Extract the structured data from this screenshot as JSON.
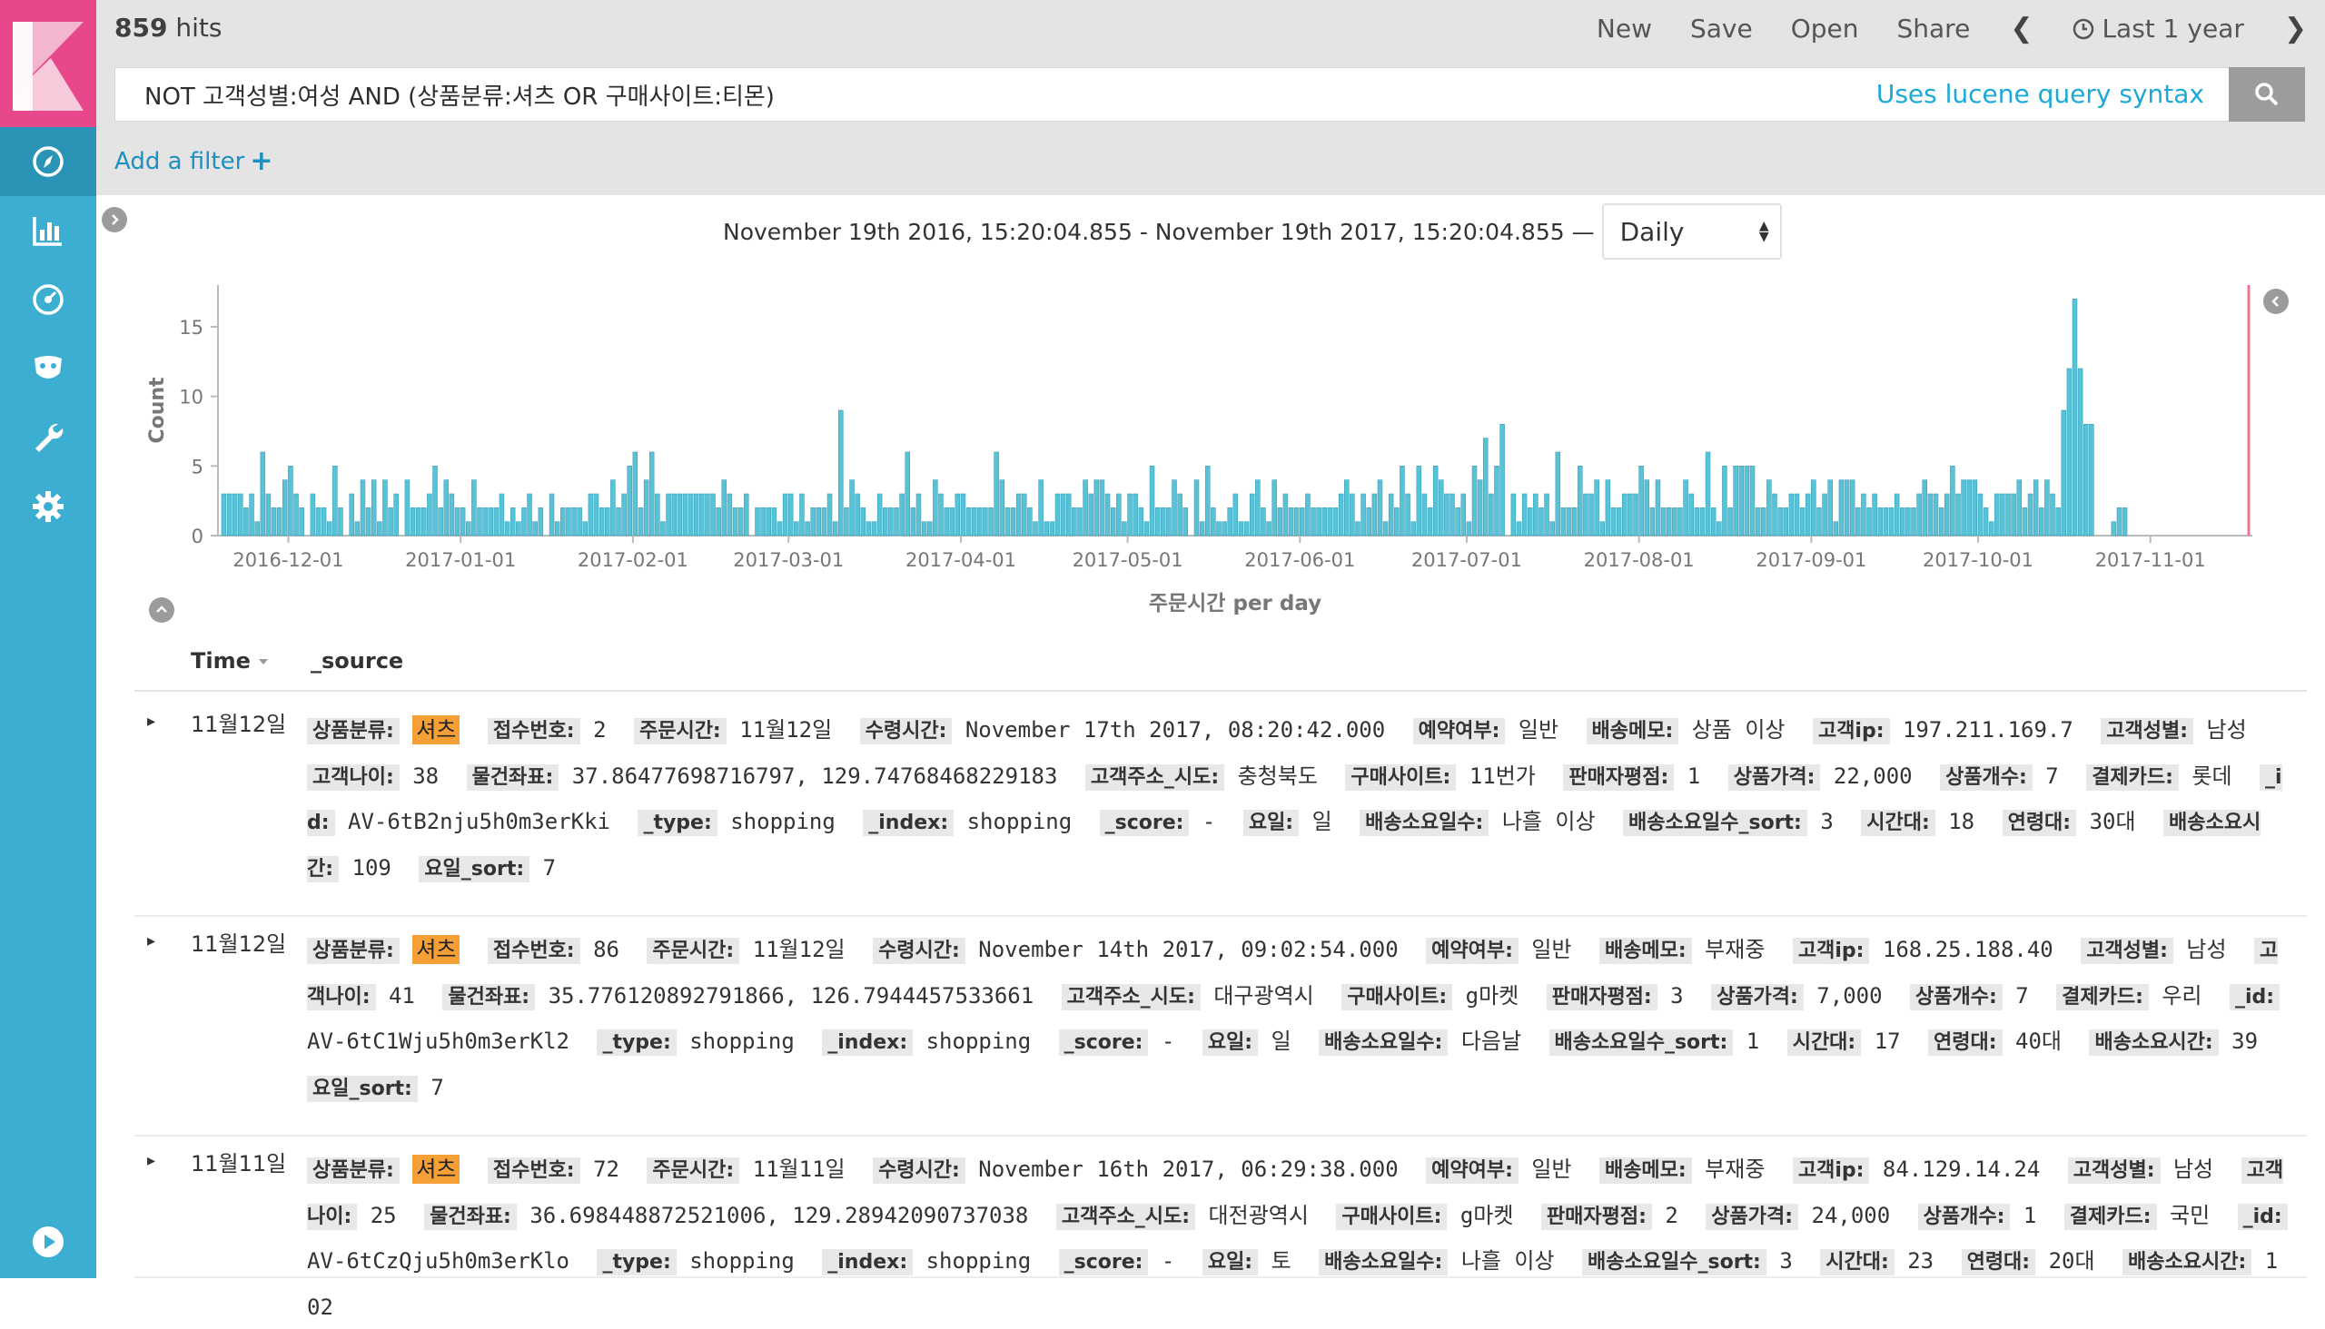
{
  "app": {
    "accent": "#3caed2",
    "logo_color": "#e8488b"
  },
  "sidebar": {
    "items": [
      {
        "name": "discover",
        "icon": "compass-icon",
        "active": true
      },
      {
        "name": "visualize",
        "icon": "bar-chart-icon"
      },
      {
        "name": "dashboard",
        "icon": "dashboard-gauge-icon"
      },
      {
        "name": "timelion",
        "icon": "timelion-mask-icon"
      },
      {
        "name": "dev-tools",
        "icon": "wrench-icon"
      },
      {
        "name": "management",
        "icon": "gear-icon"
      }
    ],
    "bottom_icon": "play-circle-icon"
  },
  "header": {
    "hits_count": "859",
    "hits_label": "hits",
    "menu": {
      "new": "New",
      "save": "Save",
      "open": "Open",
      "share": "Share"
    },
    "time_range_label": "Last 1 year"
  },
  "query": {
    "value": "NOT 고객성별:여성 AND (상품분류:셔츠 OR 구매사이트:티몬)",
    "syntax_link": "Uses lucene query syntax"
  },
  "filter": {
    "add_label": "Add a filter"
  },
  "chart_meta": {
    "range_text": "November 19th 2016, 15:20:04.855 - November 19th 2017, 15:20:04.855 —",
    "interval": "Daily"
  },
  "chart_data": {
    "type": "bar",
    "ylabel": "Count",
    "xlabel": "주문시간 per day",
    "ylim": [
      0,
      18
    ],
    "yticks": [
      0,
      5,
      10,
      15
    ],
    "xticks": [
      "2016-12-01",
      "2017-01-01",
      "2017-02-01",
      "2017-03-01",
      "2017-04-01",
      "2017-05-01",
      "2017-06-01",
      "2017-07-01",
      "2017-08-01",
      "2017-09-01",
      "2017-10-01",
      "2017-11-01"
    ],
    "start_date": "2016-11-19",
    "values": [
      3,
      3,
      3,
      3,
      2,
      3,
      1,
      6,
      3,
      2,
      2,
      4,
      5,
      3,
      2,
      0,
      3,
      2,
      2,
      1,
      5,
      2,
      0,
      3,
      1,
      4,
      2,
      4,
      1,
      4,
      2,
      3,
      0,
      4,
      2,
      2,
      2,
      3,
      5,
      2,
      4,
      3,
      2,
      2,
      1,
      4,
      2,
      2,
      2,
      2,
      3,
      1,
      2,
      1,
      2,
      3,
      1,
      2,
      0,
      3,
      1,
      2,
      2,
      2,
      2,
      1,
      3,
      3,
      2,
      2,
      4,
      2,
      3,
      5,
      6,
      2,
      4,
      6,
      3,
      1,
      3,
      3,
      3,
      3,
      3,
      3,
      3,
      3,
      3,
      2,
      4,
      3,
      2,
      2,
      3,
      0,
      2,
      2,
      2,
      2,
      1,
      3,
      3,
      1,
      3,
      1,
      2,
      2,
      2,
      3,
      1,
      9,
      2,
      4,
      3,
      2,
      1,
      1,
      3,
      2,
      2,
      2,
      3,
      6,
      2,
      3,
      1,
      1,
      4,
      3,
      2,
      2,
      3,
      3,
      2,
      2,
      2,
      2,
      2,
      6,
      4,
      2,
      2,
      3,
      3,
      2,
      1,
      4,
      1,
      1,
      3,
      3,
      3,
      2,
      2,
      4,
      3,
      4,
      4,
      3,
      2,
      3,
      1,
      3,
      3,
      2,
      1,
      5,
      2,
      2,
      2,
      4,
      3,
      2,
      0,
      4,
      1,
      5,
      2,
      1,
      1,
      2,
      3,
      1,
      1,
      3,
      4,
      2,
      1,
      4,
      2,
      3,
      2,
      2,
      2,
      3,
      2,
      2,
      2,
      2,
      2,
      3,
      4,
      3,
      1,
      3,
      2,
      3,
      4,
      1,
      3,
      2,
      5,
      3,
      1,
      5,
      3,
      2,
      5,
      4,
      3,
      3,
      2,
      3,
      1,
      5,
      4,
      7,
      3,
      5,
      8,
      0,
      3,
      1,
      3,
      2,
      3,
      2,
      3,
      1,
      6,
      2,
      2,
      2,
      5,
      3,
      3,
      4,
      1,
      4,
      2,
      2,
      3,
      3,
      3,
      5,
      4,
      2,
      4,
      2,
      2,
      2,
      2,
      4,
      3,
      2,
      2,
      6,
      2,
      1,
      5,
      2,
      5,
      5,
      5,
      5,
      2,
      2,
      4,
      3,
      2,
      2,
      3,
      3,
      2,
      3,
      4,
      2,
      3,
      4,
      1,
      4,
      4,
      4,
      2,
      3,
      2,
      3,
      2,
      2,
      2,
      3,
      2,
      2,
      2,
      3,
      4,
      3,
      3,
      2,
      3,
      5,
      3,
      4,
      4,
      4,
      3,
      2,
      1,
      3,
      3,
      3,
      3,
      4,
      2,
      3,
      4,
      2,
      4,
      3,
      2,
      9,
      12,
      17,
      12,
      8,
      8,
      0,
      0,
      0,
      1,
      2,
      2
    ],
    "highlight_color": "#57c3d8"
  },
  "table": {
    "col_time": "Time",
    "col_source": "_source",
    "rows": [
      {
        "time": "11월12일",
        "fields": [
          {
            "k": "상품분류:",
            "v": "셔츠",
            "hl": true
          },
          {
            "k": "접수번호:",
            "v": "2"
          },
          {
            "k": "주문시간:",
            "v": "11월12일"
          },
          {
            "k": "수령시간:",
            "v": "November 17th 2017, 08:20:42.000"
          },
          {
            "k": "예약여부:",
            "v": "일반"
          },
          {
            "k": "배송메모:",
            "v": "상품 이상"
          },
          {
            "k": "고객ip:",
            "v": "197.211.169.7"
          },
          {
            "k": "고객성별:",
            "v": "남성"
          },
          {
            "k": "고객나이:",
            "v": "38"
          },
          {
            "k": "물건좌표:",
            "v": "37.86477698716797, 129.74768468229183"
          },
          {
            "k": "고객주소_시도:",
            "v": "충청북도"
          },
          {
            "k": "구매사이트:",
            "v": "11번가"
          },
          {
            "k": "판매자평점:",
            "v": "1"
          },
          {
            "k": "상품가격:",
            "v": "22,000"
          },
          {
            "k": "상품개수:",
            "v": "7"
          },
          {
            "k": "결제카드:",
            "v": "롯데"
          },
          {
            "k": "_id:",
            "v": "AV-6tB2nju5h0m3erKki"
          },
          {
            "k": "_type:",
            "v": "shopping"
          },
          {
            "k": "_index:",
            "v": "shopping"
          },
          {
            "k": "_score:",
            "v": "-"
          },
          {
            "k": "요일:",
            "v": "일"
          },
          {
            "k": "배송소요일수:",
            "v": "나흘 이상"
          },
          {
            "k": "배송소요일수_sort:",
            "v": "3"
          },
          {
            "k": "시간대:",
            "v": "18"
          },
          {
            "k": "연령대:",
            "v": "30대"
          },
          {
            "k": "배송소요시간:",
            "v": "109"
          },
          {
            "k": "요일_sort:",
            "v": "7"
          }
        ]
      },
      {
        "time": "11월12일",
        "fields": [
          {
            "k": "상품분류:",
            "v": "셔츠",
            "hl": true
          },
          {
            "k": "접수번호:",
            "v": "86"
          },
          {
            "k": "주문시간:",
            "v": "11월12일"
          },
          {
            "k": "수령시간:",
            "v": "November 14th 2017, 09:02:54.000"
          },
          {
            "k": "예약여부:",
            "v": "일반"
          },
          {
            "k": "배송메모:",
            "v": "부재중"
          },
          {
            "k": "고객ip:",
            "v": "168.25.188.40"
          },
          {
            "k": "고객성별:",
            "v": "남성"
          },
          {
            "k": "고객나이:",
            "v": "41"
          },
          {
            "k": "물건좌표:",
            "v": "35.776120892791866, 126.7944457533661"
          },
          {
            "k": "고객주소_시도:",
            "v": "대구광역시"
          },
          {
            "k": "구매사이트:",
            "v": "g마켓"
          },
          {
            "k": "판매자평점:",
            "v": "3"
          },
          {
            "k": "상품가격:",
            "v": "7,000"
          },
          {
            "k": "상품개수:",
            "v": "7"
          },
          {
            "k": "결제카드:",
            "v": "우리"
          },
          {
            "k": "_id:",
            "v": "AV-6tC1Wju5h0m3erKl2"
          },
          {
            "k": "_type:",
            "v": "shopping"
          },
          {
            "k": "_index:",
            "v": "shopping"
          },
          {
            "k": "_score:",
            "v": "-"
          },
          {
            "k": "요일:",
            "v": "일"
          },
          {
            "k": "배송소요일수:",
            "v": "다음날"
          },
          {
            "k": "배송소요일수_sort:",
            "v": "1"
          },
          {
            "k": "시간대:",
            "v": "17"
          },
          {
            "k": "연령대:",
            "v": "40대"
          },
          {
            "k": "배송소요시간:",
            "v": "39"
          },
          {
            "k": "요일_sort:",
            "v": "7"
          }
        ]
      },
      {
        "time": "11월11일",
        "fields": [
          {
            "k": "상품분류:",
            "v": "셔츠",
            "hl": true
          },
          {
            "k": "접수번호:",
            "v": "72"
          },
          {
            "k": "주문시간:",
            "v": "11월11일"
          },
          {
            "k": "수령시간:",
            "v": "November 16th 2017, 06:29:38.000"
          },
          {
            "k": "예약여부:",
            "v": "일반"
          },
          {
            "k": "배송메모:",
            "v": "부재중"
          },
          {
            "k": "고객ip:",
            "v": "84.129.14.24"
          },
          {
            "k": "고객성별:",
            "v": "남성"
          },
          {
            "k": "고객나이:",
            "v": "25"
          },
          {
            "k": "물건좌표:",
            "v": "36.698448872521006, 129.28942090737038"
          },
          {
            "k": "고객주소_시도:",
            "v": "대전광역시"
          },
          {
            "k": "구매사이트:",
            "v": "g마켓"
          },
          {
            "k": "판매자평점:",
            "v": "2"
          },
          {
            "k": "상품가격:",
            "v": "24,000"
          },
          {
            "k": "상품개수:",
            "v": "1"
          },
          {
            "k": "결제카드:",
            "v": "국민"
          },
          {
            "k": "_id:",
            "v": "AV-6tCzQju5h0m3erKlo"
          },
          {
            "k": "_type:",
            "v": "shopping"
          },
          {
            "k": "_index:",
            "v": "shopping"
          },
          {
            "k": "_score:",
            "v": "-"
          },
          {
            "k": "요일:",
            "v": "토"
          },
          {
            "k": "배송소요일수:",
            "v": "나흘 이상"
          },
          {
            "k": "배송소요일수_sort:",
            "v": "3"
          },
          {
            "k": "시간대:",
            "v": "23"
          },
          {
            "k": "연령대:",
            "v": "20대"
          },
          {
            "k": "배송소요시간:",
            "v": "102"
          }
        ]
      }
    ]
  }
}
